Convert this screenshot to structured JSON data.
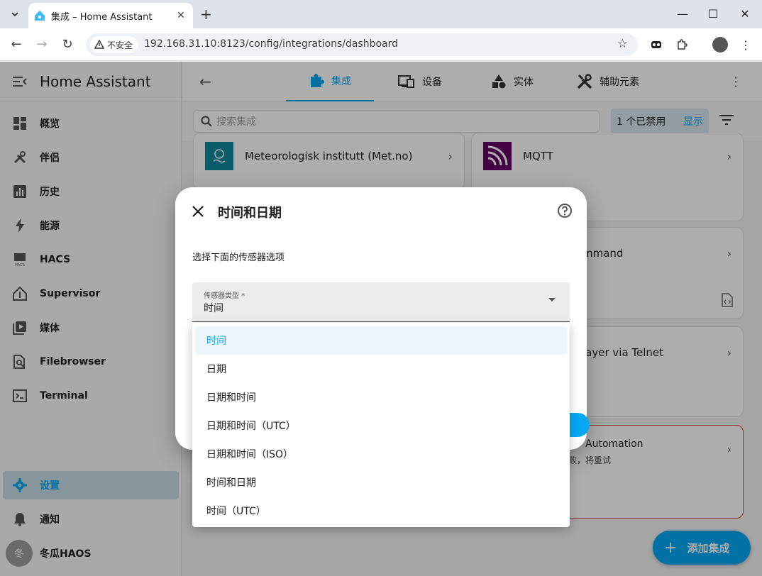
{
  "browser": {
    "tab_title": "集成 – Home Assistant",
    "security_label": "不安全",
    "url": "192.168.31.10:8123/config/integrations/dashboard"
  },
  "sidebar": {
    "title": "Home Assistant",
    "items": [
      {
        "label": "概览",
        "icon": "dashboard-icon"
      },
      {
        "label": "伴侣",
        "icon": "tools-icon"
      },
      {
        "label": "历史",
        "icon": "chart-icon"
      },
      {
        "label": "能源",
        "icon": "lightning-icon"
      },
      {
        "label": "HACS",
        "icon": "hacs-icon"
      },
      {
        "label": "Supervisor",
        "icon": "supervisor-icon"
      },
      {
        "label": "媒体",
        "icon": "media-icon"
      },
      {
        "label": "Filebrowser",
        "icon": "file-search-icon"
      },
      {
        "label": "Terminal",
        "icon": "terminal-icon"
      }
    ],
    "settings": "设置",
    "notifications": "通知",
    "user_name": "冬瓜HAOS",
    "user_initial": "冬"
  },
  "topnav": {
    "tabs": [
      {
        "label": "集成",
        "icon": "puzzle-icon",
        "active": true
      },
      {
        "label": "设备",
        "icon": "devices-icon"
      },
      {
        "label": "实体",
        "icon": "shapes-icon"
      },
      {
        "label": "辅助元素",
        "icon": "tools-icon"
      }
    ]
  },
  "search": {
    "placeholder": "搜索集成",
    "disabled_count": "1 个已禁用",
    "show_label": "显示"
  },
  "integrations": {
    "met": "Meteorologisk institutt (Met.no)",
    "mqtt": "MQTT",
    "command_fragment": "mmand",
    "telnet_fragment": "layer via Telnet",
    "automation_fragment": "Automation",
    "retry_fragment": "败，将重试"
  },
  "fab_label": "添加集成",
  "dialog": {
    "title": "时间和日期",
    "description": "选择下面的传感器选项",
    "field_label": "传感器类型 *",
    "field_value": "时间",
    "options": [
      "时间",
      "日期",
      "日期和时间",
      "日期和时间（UTC）",
      "日期和时间（ISO）",
      "时间和日期",
      "时间（UTC）"
    ],
    "selected_index": 0
  },
  "colors": {
    "accent": "#03a9f4",
    "sidebar_active_bg": "#c6dde6",
    "error_border": "#db4437"
  }
}
